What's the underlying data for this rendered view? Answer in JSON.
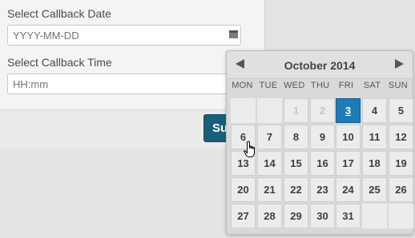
{
  "form": {
    "date_label": "Select Callback Date",
    "date_placeholder": "YYYY-MM-DD",
    "time_label": "Select Callback Time",
    "time_placeholder": "HH:mm",
    "submit_label": "Submit"
  },
  "datepicker": {
    "month_title": "October 2014",
    "days_of_week": [
      "MON",
      "TUE",
      "WED",
      "THU",
      "FRI",
      "SAT",
      "SUN"
    ],
    "selected_day": "3",
    "weeks": [
      [
        "",
        "",
        "1",
        "2",
        "3",
        "4",
        "5"
      ],
      [
        "6",
        "7",
        "8",
        "9",
        "10",
        "11",
        "12"
      ],
      [
        "13",
        "14",
        "15",
        "16",
        "17",
        "18",
        "19"
      ],
      [
        "20",
        "21",
        "22",
        "23",
        "24",
        "25",
        "26"
      ],
      [
        "27",
        "28",
        "29",
        "30",
        "31",
        "",
        ""
      ]
    ],
    "disabled_days": [
      "1",
      "2"
    ]
  },
  "colors": {
    "selected_day_bg": "#1d7cb8",
    "submit_bg": "#1a5f7a"
  }
}
